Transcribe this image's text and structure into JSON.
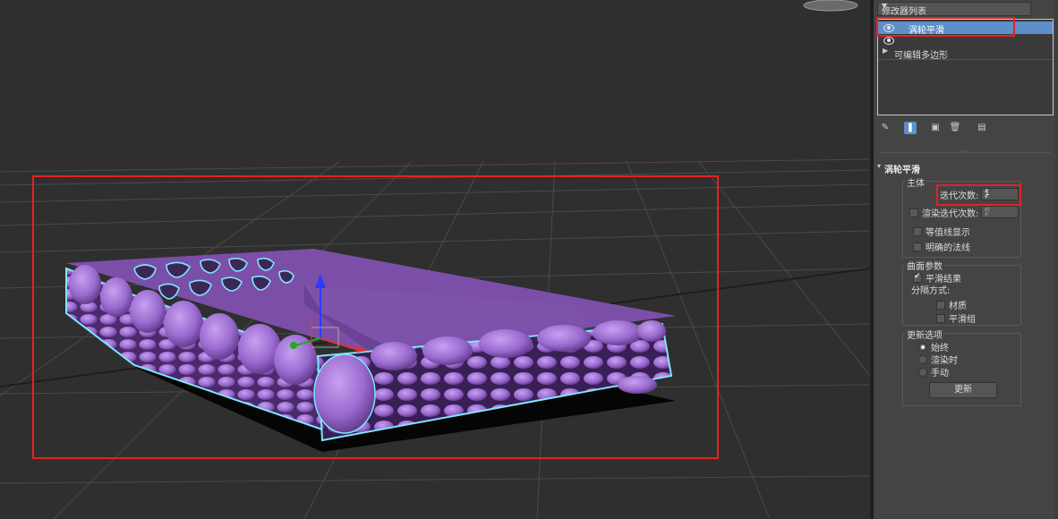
{
  "panel": {
    "modifier_list_label": "修改器列表",
    "stack_items": [
      {
        "label": "涡轮平滑",
        "selected": true
      },
      {
        "label": "可编辑多边形",
        "selected": false
      }
    ],
    "rollout_title": "涡轮平滑",
    "main_group": {
      "label": "主体",
      "iterations_label": "迭代次数:",
      "iterations_value": "1",
      "render_iters_label": "渲染迭代次数:",
      "render_iters_value": "0",
      "isoline_label": "等值线显示",
      "explicit_normals_label": "明确的法线"
    },
    "surface_group": {
      "label": "曲面参数",
      "smooth_result_label": "平滑结果",
      "separate_by_label": "分隔方式:",
      "materials_label": "材质",
      "smoothing_groups_label": "平滑组"
    },
    "update_group": {
      "label": "更新选项",
      "always_label": "始终",
      "when_rendering_label": "渲染时",
      "manually_label": "手动",
      "update_button": "更新"
    }
  },
  "colors": {
    "viewport_bg": "#2f2f2f",
    "object_fill": "#7b4fa8",
    "object_cell": "#9a6bd0",
    "selection_outline": "#7fe5ff",
    "highlight_box": "#e52222",
    "panel_bg": "#444444",
    "selected_row": "#5e8fc9"
  }
}
